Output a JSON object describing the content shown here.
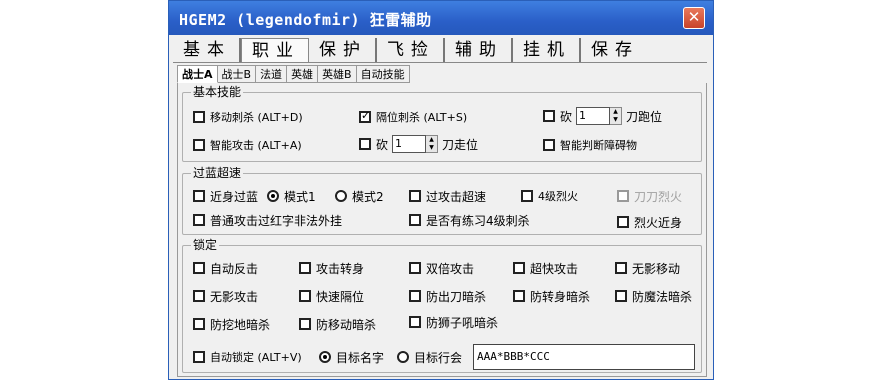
{
  "window": {
    "title": "HGEM2 (legendofmir) 狂雷辅助",
    "close_glyph": "✕"
  },
  "main_tabs": [
    "基本",
    "职业",
    "保护",
    "飞捡",
    "辅助",
    "挂机",
    "保存"
  ],
  "sub_tabs": [
    "战士A",
    "战士B",
    "法道",
    "英雄",
    "英雄B",
    "自动技能"
  ],
  "groups": {
    "basic": {
      "legend": "基本技能",
      "move_stab": "移动刺杀 (ALT+D)",
      "sep_stab": "隔位刺杀 (ALT+S)",
      "chop_prefix": "砍",
      "chop_value": "1",
      "run_suffix": "刀跑位",
      "smart_attack": "智能攻击 (ALT+A)",
      "chop2_prefix": "砍",
      "chop2_value": "1",
      "walk_suffix": "刀走位",
      "smart_obstacle": "智能判断障碍物"
    },
    "pass": {
      "legend": "过蓝超速",
      "near_pass": "近身过蓝",
      "mode1": "模式1",
      "mode2": "模式2",
      "attack_speed": "过攻击超速",
      "fire4": "4级烈火",
      "blade_fire": "刀刀烈火",
      "normal_attack": "普通攻击过红字非法外挂",
      "practice4": "是否有练习4级刺杀",
      "fire_near": "烈火近身"
    },
    "lock": {
      "legend": "锁定",
      "items": [
        [
          "自动反击",
          "攻击转身",
          "双倍攻击",
          "超快攻击",
          "无影移动"
        ],
        [
          "无影攻击",
          "快速隔位",
          "防出刀暗杀",
          "防转身暗杀",
          "防魔法暗杀"
        ],
        [
          "防挖地暗杀",
          "防移动暗杀",
          "防狮子吼暗杀"
        ]
      ],
      "auto_lock": "自动锁定 (ALT+V)",
      "target_name": "目标名字",
      "target_guild": "目标行会",
      "target_input": "AAA*BBB*CCC"
    }
  },
  "spin_arrows": {
    "up": "▲",
    "down": "▼"
  }
}
